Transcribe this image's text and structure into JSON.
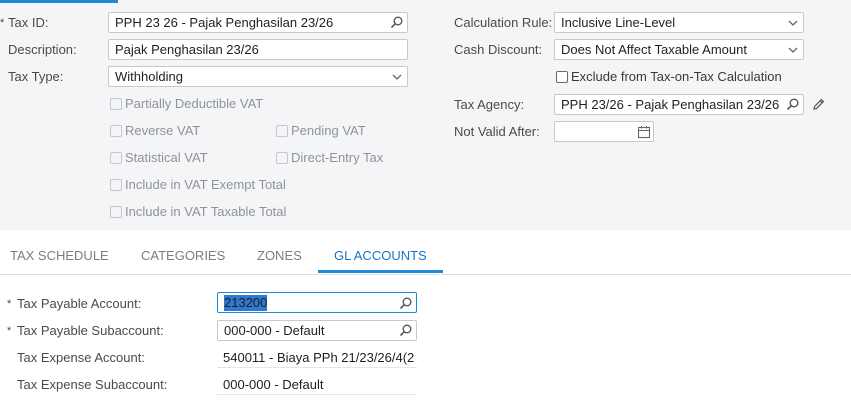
{
  "form": {
    "tax_id": {
      "label": "Tax ID:",
      "value": "PPH 23 26 - Pajak Penghasilan 23/26",
      "required": "*"
    },
    "description": {
      "label": "Description:",
      "value": "Pajak Penghasilan 23/26"
    },
    "tax_type": {
      "label": "Tax Type:",
      "value": "Withholding"
    },
    "calculation_rule": {
      "label": "Calculation Rule:",
      "value": "Inclusive Line-Level"
    },
    "cash_discount": {
      "label": "Cash Discount:",
      "value": "Does Not Affect Taxable Amount"
    },
    "exclude_tax_on_tax": {
      "label": "Exclude from Tax-on-Tax Calculation",
      "checked": false
    },
    "tax_agency": {
      "label": "Tax Agency:",
      "value": "PPH 23/26 - Pajak Penghasilan 23/26"
    },
    "not_valid_after": {
      "label": "Not Valid After:",
      "value": ""
    },
    "checkboxes": {
      "partially_deductible_vat": {
        "label": "Partially Deductible VAT",
        "checked": false,
        "enabled": false
      },
      "reverse_vat": {
        "label": "Reverse VAT",
        "checked": false,
        "enabled": false
      },
      "pending_vat": {
        "label": "Pending VAT",
        "checked": false,
        "enabled": false
      },
      "statistical_vat": {
        "label": "Statistical VAT",
        "checked": false,
        "enabled": false
      },
      "direct_entry_tax": {
        "label": "Direct-Entry Tax",
        "checked": false,
        "enabled": false
      },
      "include_vat_exempt": {
        "label": "Include in VAT Exempt Total",
        "checked": false,
        "enabled": false
      },
      "include_vat_taxable": {
        "label": "Include in VAT Taxable Total",
        "checked": false,
        "enabled": false
      }
    }
  },
  "tabs": [
    {
      "label": "TAX SCHEDULE",
      "active": false
    },
    {
      "label": "CATEGORIES",
      "active": false
    },
    {
      "label": "ZONES",
      "active": false
    },
    {
      "label": "GL ACCOUNTS",
      "active": true
    }
  ],
  "gl_accounts": {
    "tax_payable_account": {
      "label": "Tax Payable Account:",
      "value": "213200",
      "required": "*"
    },
    "tax_payable_subaccount": {
      "label": "Tax Payable Subaccount:",
      "value": "000-000 - Default",
      "required": "*"
    },
    "tax_expense_account": {
      "label": "Tax Expense Account:",
      "value": "540011 - Biaya PPh 21/23/26/4(2"
    },
    "tax_expense_subaccount": {
      "label": "Tax Expense Subaccount:",
      "value": "000-000 - Default"
    }
  },
  "icons": {
    "search": "search-icon",
    "dropdown": "chevron-down-icon",
    "edit": "pencil-icon",
    "calendar": "calendar-icon"
  },
  "colors": {
    "accent": "#1e8ad6",
    "active_tab": "#1a74c4",
    "selection": "#2f7ad0"
  }
}
